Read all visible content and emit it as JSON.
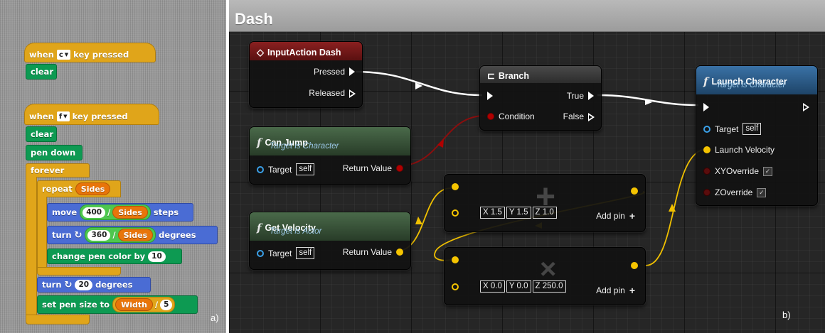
{
  "scratch": {
    "panel_tag": "a)",
    "script1": {
      "hat_when": "when",
      "hat_key": "c",
      "hat_rest": "key pressed",
      "clear": "clear"
    },
    "script2": {
      "hat_when": "when",
      "hat_key": "f",
      "hat_rest": "key pressed",
      "clear": "clear",
      "pen_down": "pen down",
      "forever": "forever",
      "repeat": "repeat",
      "repeat_var": "Sides",
      "move": "move",
      "move_num": "400",
      "div": "/",
      "move_var": "Sides",
      "move_tail": "steps",
      "turn": "turn",
      "turn_num": "360",
      "turn_var": "Sides",
      "turn_tail": "degrees",
      "change_pen": "change pen color by",
      "change_num": "10",
      "turn2": "turn",
      "turn2_num": "20",
      "turn2_tail": "degrees",
      "set_pen": "set pen size to",
      "set_var": "Width",
      "set_num": "5"
    }
  },
  "blueprint": {
    "graph_title": "Dash",
    "panel_tag": "b)",
    "input_action": {
      "title": "InputAction Dash",
      "pressed": "Pressed",
      "released": "Released"
    },
    "can_jump": {
      "title": "Can Jump",
      "subtitle": "Target is Character",
      "target": "Target",
      "self": "self",
      "return": "Return Value"
    },
    "get_velocity": {
      "title": "Get Velocity",
      "subtitle": "Target is Actor",
      "target": "Target",
      "self": "self",
      "return": "Return Value"
    },
    "branch": {
      "title": "Branch",
      "condition": "Condition",
      "true": "True",
      "false": "False"
    },
    "make_vec1": {
      "x": "X 1.5",
      "y": "Y 1.5",
      "z": "Z 1.0",
      "add_pin": "Add pin"
    },
    "make_vec2": {
      "x": "X 0.0",
      "y": "Y 0.0",
      "z": "Z 250.0",
      "add_pin": "Add pin"
    },
    "launch": {
      "title": "Launch Character",
      "subtitle": "Target is Character",
      "target": "Target",
      "self": "self",
      "launch_velocity": "Launch Velocity",
      "xy_override": "XYOverride",
      "z_override": "ZOverride"
    },
    "colors": {
      "input_action_header": "#7a1a1a",
      "function_header": "#385238",
      "branch_header": "#3c3c3c",
      "launch_header": "#2c5c86",
      "exec_wire": "#ffffff",
      "bool_wire": "#8a0e0e",
      "vector_wire": "#f0c000"
    }
  }
}
